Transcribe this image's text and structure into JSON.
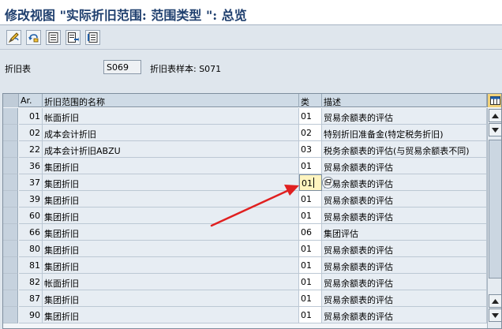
{
  "window": {
    "title": "修改视图 \"实际折旧范围: 范围类型 \": 总览"
  },
  "toolbar": {
    "buttons": [
      {
        "name": "change-icon"
      },
      {
        "name": "undo-icon"
      },
      {
        "name": "details-icon"
      },
      {
        "name": "export-icon"
      },
      {
        "name": "print-icon"
      }
    ]
  },
  "header_fields": {
    "chart_label": "折旧表",
    "chart_value": "S069",
    "sample_label": "折旧表样本: S071"
  },
  "table": {
    "columns": [
      "Ar.",
      "折旧范围的名称",
      "类",
      "描述"
    ],
    "rows": [
      {
        "ar": "01",
        "name": "帐面折旧",
        "cls": "01",
        "desc": "贸易余额表的评估"
      },
      {
        "ar": "02",
        "name": "成本会计折旧",
        "cls": "02",
        "desc": "特别折旧准备金(特定税务折旧)"
      },
      {
        "ar": "22",
        "name": "成本会计折旧ABZU",
        "cls": "03",
        "desc": "税务余额表的评估(与贸易余额表不同)"
      },
      {
        "ar": "36",
        "name": "集团折旧",
        "cls": "01",
        "desc": "贸易余额表的评估"
      },
      {
        "ar": "37",
        "name": "集团折旧",
        "cls": "01",
        "desc": "贸易余额表的评估"
      },
      {
        "ar": "39",
        "name": "集团折旧",
        "cls": "01",
        "desc": "贸易余额表的评估"
      },
      {
        "ar": "60",
        "name": "集团折旧",
        "cls": "01",
        "desc": "贸易余额表的评估"
      },
      {
        "ar": "66",
        "name": "集团折旧",
        "cls": "06",
        "desc": "集团评估"
      },
      {
        "ar": "80",
        "name": "集团折旧",
        "cls": "01",
        "desc": "贸易余额表的评估"
      },
      {
        "ar": "81",
        "name": "集团折旧",
        "cls": "01",
        "desc": "贸易余额表的评估"
      },
      {
        "ar": "82",
        "name": "帐面折旧",
        "cls": "01",
        "desc": "贸易余额表的评估"
      },
      {
        "ar": "87",
        "name": "集团折旧",
        "cls": "01",
        "desc": "贸易余额表的评估"
      },
      {
        "ar": "90",
        "name": "集团折旧",
        "cls": "01",
        "desc": "贸易余额表的评估"
      }
    ],
    "active_row_index": 4
  },
  "colors": {
    "title": "#1f3f6e",
    "header_bg": "#cfdbe6",
    "active_cell": "#fff4bf",
    "annotation_arrow": "#e02020"
  }
}
